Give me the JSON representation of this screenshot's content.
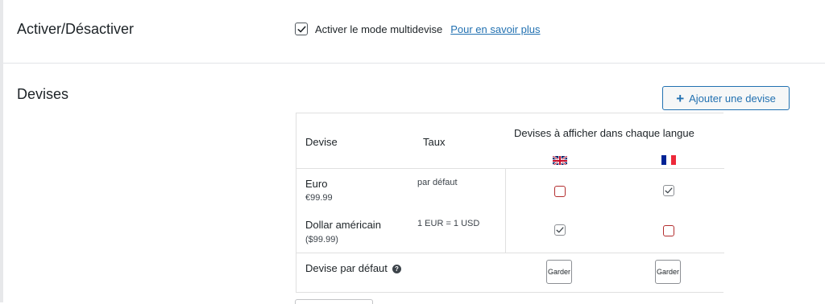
{
  "toggle_section": {
    "label": "Activer/Désactiver",
    "checkbox_label": "Activer le mode multidevise",
    "checked": true,
    "learn_more": "Pour en savoir plus"
  },
  "currencies_section": {
    "label": "Devises",
    "add_button": "Ajouter une devise",
    "add_icon": "plus-icon",
    "table": {
      "col_currency": "Devise",
      "col_rate": "Taux",
      "col_languages": "Devises à afficher dans chaque langue",
      "languages": [
        {
          "flag": "uk-flag-icon",
          "code": "en"
        },
        {
          "flag": "fr-flag-icon",
          "code": "fr"
        }
      ],
      "rows": [
        {
          "name": "Euro",
          "price": "€99.99",
          "rate": "par défaut",
          "en": false,
          "fr": true
        },
        {
          "name": "Dollar américain",
          "price": "($99.99)",
          "rate": "1 EUR = 1 USD",
          "en": true,
          "fr": false
        }
      ],
      "default_row": {
        "label": "Devise par défaut",
        "help_icon": "question-icon",
        "keep_label": "Garder"
      }
    }
  },
  "colors": {
    "accent": "#2271b1",
    "text": "#1d2327",
    "unchecked_border": "#b32d2e"
  }
}
